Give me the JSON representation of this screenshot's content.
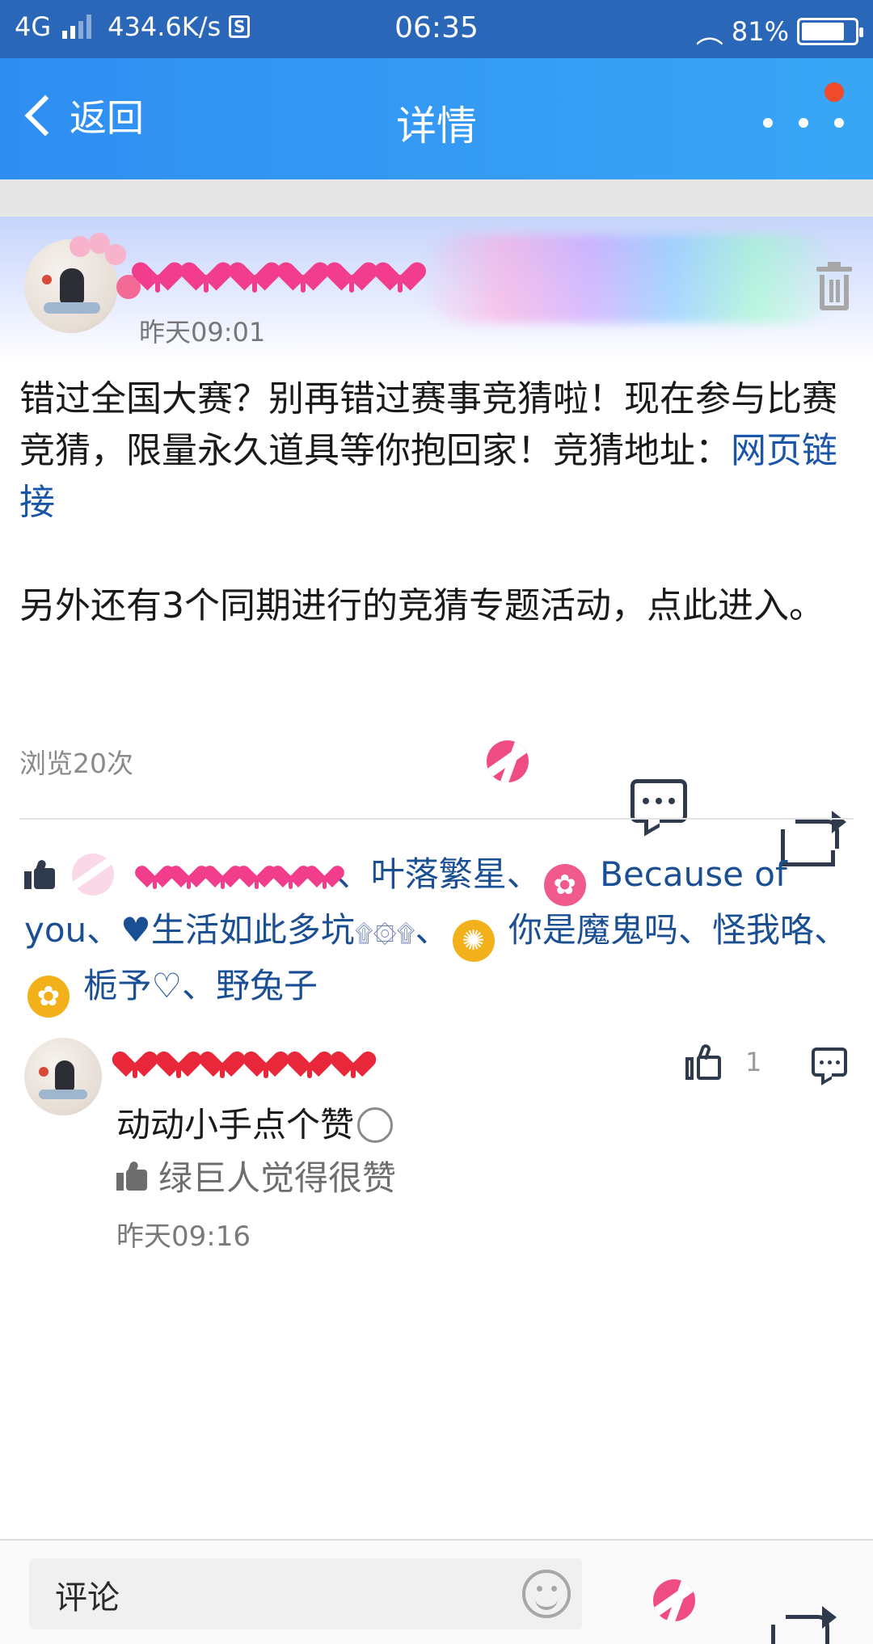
{
  "status_bar": {
    "network": "4G",
    "speed": "434.6K/s",
    "s_icon": "S",
    "time": "06:35",
    "battery": "81%",
    "battery_level": 0.81
  },
  "header": {
    "back_label": "返回",
    "title": "详情"
  },
  "post": {
    "time": "昨天09:01",
    "content_line1_text": "错过全国大赛？别再错过赛事竞猜啦！现在参与比赛竞猜，限量永久道具等你抱回家！竞猜地址：",
    "content_link": "网页链接",
    "content_para2": "另外还有3个同期进行的竞猜专题活动，点此进入。",
    "views": "浏览20次"
  },
  "likers": {
    "sep": "、",
    "names": [
      "叶落繁星",
      "Because of you",
      "♥生活如此多坑",
      "你是魔鬼吗",
      "怪我咯",
      "栀予♡",
      "野兔子"
    ],
    "deco": "۩۞۩"
  },
  "comment": {
    "like_count": "1",
    "text": "动动小手点个赞",
    "liked_by": "绿巨人觉得很赞",
    "time": "昨天09:16"
  },
  "bottom_bar": {
    "comment_placeholder": "评论"
  },
  "colors": {
    "status_bar": "#2a67b8",
    "title_bar": "#2f8ef2",
    "link": "#1a56a8",
    "liker_name": "#1a4f94",
    "heart_pink": "#f23d8c",
    "heart_red": "#e8273a",
    "notification_dot": "#f04a2c"
  },
  "icons": [
    "back-chevron-icon",
    "more-icon",
    "trash-icon",
    "ball-icon",
    "comment-icon",
    "share-icon",
    "thumb-up-icon",
    "emoji-icon"
  ]
}
